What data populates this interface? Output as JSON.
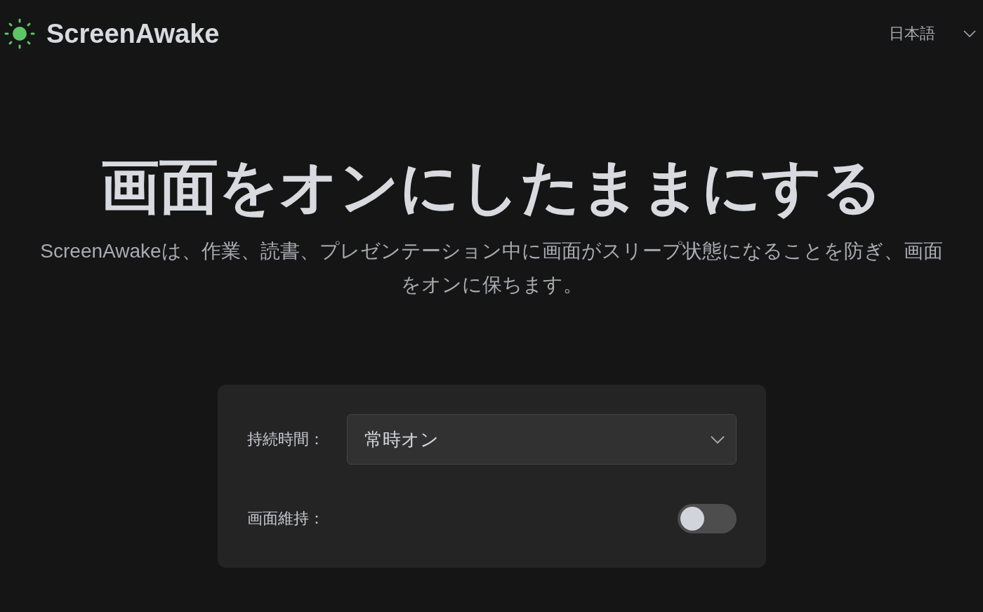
{
  "header": {
    "brand": "ScreenAwake",
    "language": "日本語"
  },
  "hero": {
    "title": "画面をオンにしたままにする",
    "subtitle": "ScreenAwakeは、作業、読書、プレゼンテーション中に画面がスリープ状態になることを防ぎ、画面をオンに保ちます。"
  },
  "settings": {
    "duration_label": "持続時間：",
    "duration_value": "常時オン",
    "keep_label": "画面維持：",
    "keep_on": false
  }
}
